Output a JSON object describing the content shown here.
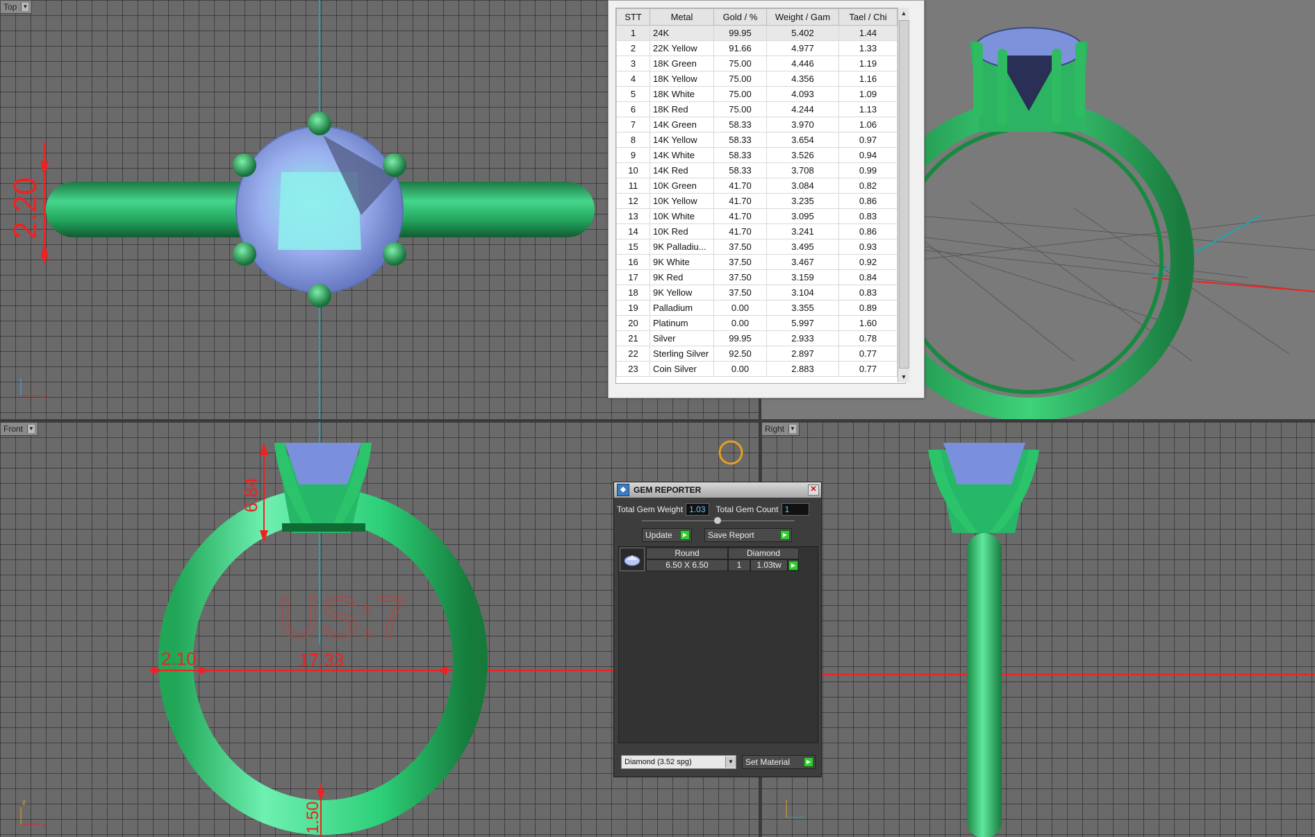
{
  "viewports": {
    "top": {
      "label": "Top"
    },
    "front": {
      "label": "Front"
    },
    "right": {
      "label": "Right"
    }
  },
  "dimensions": {
    "top_height": "2.20",
    "front_prong_height": "6.84",
    "front_shank_width": "2.10",
    "front_inner_diameter": "17.33",
    "front_bottom_thickness": "1.50",
    "size_label": "US:7"
  },
  "axes": {
    "x": "x",
    "z": "z"
  },
  "metal_table": {
    "headers": [
      "STT",
      "Metal",
      "Gold / %",
      "Weight / Gam",
      "Tael / Chi"
    ],
    "rows": [
      [
        "1",
        "24K",
        "99.95",
        "5.402",
        "1.44"
      ],
      [
        "2",
        "22K Yellow",
        "91.66",
        "4.977",
        "1.33"
      ],
      [
        "3",
        "18K Green",
        "75.00",
        "4.446",
        "1.19"
      ],
      [
        "4",
        "18K Yellow",
        "75.00",
        "4.356",
        "1.16"
      ],
      [
        "5",
        "18K White",
        "75.00",
        "4.093",
        "1.09"
      ],
      [
        "6",
        "18K Red",
        "75.00",
        "4.244",
        "1.13"
      ],
      [
        "7",
        "14K Green",
        "58.33",
        "3.970",
        "1.06"
      ],
      [
        "8",
        "14K Yellow",
        "58.33",
        "3.654",
        "0.97"
      ],
      [
        "9",
        "14K White",
        "58.33",
        "3.526",
        "0.94"
      ],
      [
        "10",
        "14K Red",
        "58.33",
        "3.708",
        "0.99"
      ],
      [
        "11",
        "10K Green",
        "41.70",
        "3.084",
        "0.82"
      ],
      [
        "12",
        "10K Yellow",
        "41.70",
        "3.235",
        "0.86"
      ],
      [
        "13",
        "10K White",
        "41.70",
        "3.095",
        "0.83"
      ],
      [
        "14",
        "10K Red",
        "41.70",
        "3.241",
        "0.86"
      ],
      [
        "15",
        "9K Palladiu...",
        "37.50",
        "3.495",
        "0.93"
      ],
      [
        "16",
        "9K White",
        "37.50",
        "3.467",
        "0.92"
      ],
      [
        "17",
        "9K Red",
        "37.50",
        "3.159",
        "0.84"
      ],
      [
        "18",
        "9K Yellow",
        "37.50",
        "3.104",
        "0.83"
      ],
      [
        "19",
        "Palladium",
        "0.00",
        "3.355",
        "0.89"
      ],
      [
        "20",
        "Platinum",
        "0.00",
        "5.997",
        "1.60"
      ],
      [
        "21",
        "Silver",
        "99.95",
        "2.933",
        "0.78"
      ],
      [
        "22",
        "Sterling Silver",
        "92.50",
        "2.897",
        "0.77"
      ],
      [
        "23",
        "Coin Silver",
        "0.00",
        "2.883",
        "0.77"
      ]
    ]
  },
  "gem_reporter": {
    "title": "GEM REPORTER",
    "total_weight_label": "Total Gem Weight",
    "total_weight_value": "1.03",
    "total_count_label": "Total Gem Count",
    "total_count_value": "1",
    "update_label": "Update",
    "save_report_label": "Save Report",
    "list_head_shape": "Round",
    "list_head_type": "Diamond",
    "list_size": "6.50 X 6.50",
    "list_count": "1",
    "list_weight": "1.03tw",
    "material_select": "Diamond    (3.52 spg)",
    "set_material_label": "Set Material"
  },
  "colors": {
    "ring_green": "#2fb85a",
    "gem_blue": "#8fa6e6",
    "dimension_red": "#e22222",
    "grid_bg": "#6a6a6a"
  }
}
